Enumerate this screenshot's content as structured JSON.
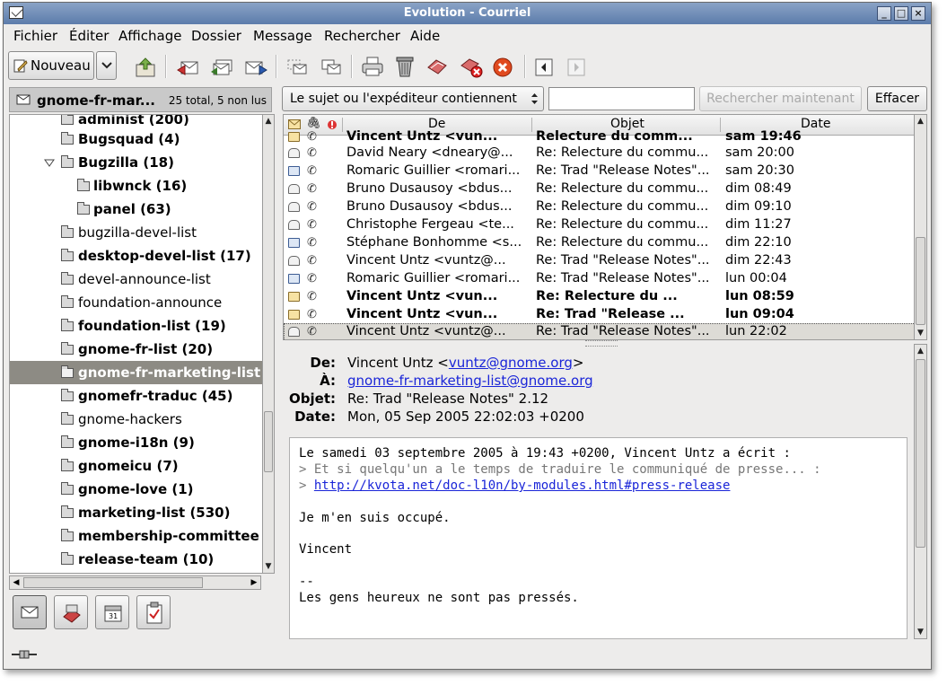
{
  "window": {
    "title": "Evolution - Courriel"
  },
  "menu": [
    "Fichier",
    "Éditer",
    "Affichage",
    "Dossier",
    "Message",
    "Rechercher",
    "Aide"
  ],
  "toolbar": {
    "new_label": "Nouveau"
  },
  "folder_header": {
    "name": "gnome-fr-mar...",
    "count": "25 total, 5 non lus"
  },
  "folders": [
    {
      "label": "administ (200)",
      "bold": true,
      "indent": 2
    },
    {
      "label": "Bugsquad (4)",
      "bold": true,
      "indent": 2
    },
    {
      "label": "Bugzilla (18)",
      "bold": true,
      "indent": 2,
      "expanded": true
    },
    {
      "label": "libwnck (16)",
      "bold": true,
      "indent": 3
    },
    {
      "label": "panel (63)",
      "bold": true,
      "indent": 3
    },
    {
      "label": "bugzilla-devel-list",
      "bold": false,
      "indent": 2
    },
    {
      "label": "desktop-devel-list (17)",
      "bold": true,
      "indent": 2
    },
    {
      "label": "devel-announce-list",
      "bold": false,
      "indent": 2
    },
    {
      "label": "foundation-announce",
      "bold": false,
      "indent": 2
    },
    {
      "label": "foundation-list (19)",
      "bold": true,
      "indent": 2
    },
    {
      "label": "gnome-fr-list (20)",
      "bold": true,
      "indent": 2
    },
    {
      "label": "gnome-fr-marketing-list",
      "bold": true,
      "indent": 2,
      "selected": true
    },
    {
      "label": "gnomefr-traduc (45)",
      "bold": true,
      "indent": 2
    },
    {
      "label": "gnome-hackers",
      "bold": false,
      "indent": 2
    },
    {
      "label": "gnome-i18n (9)",
      "bold": true,
      "indent": 2
    },
    {
      "label": "gnomeicu (7)",
      "bold": true,
      "indent": 2
    },
    {
      "label": "gnome-love (1)",
      "bold": true,
      "indent": 2
    },
    {
      "label": "marketing-list (530)",
      "bold": true,
      "indent": 2
    },
    {
      "label": "membership-committee",
      "bold": true,
      "indent": 2
    },
    {
      "label": "release-team (10)",
      "bold": true,
      "indent": 2
    }
  ],
  "search": {
    "scope": "Le sujet ou l'expéditeur contiennent",
    "query": "",
    "search_now": "Rechercher maintenant",
    "clear": "Effacer"
  },
  "message_list": {
    "columns": {
      "from": "De",
      "subject": "Objet",
      "date": "Date"
    },
    "rows": [
      {
        "from": "Vincent Untz <vun...",
        "subject": "Relecture du comm...",
        "date": "sam 19:46",
        "status": "unread",
        "bold": true
      },
      {
        "from": "David Neary <dneary@...",
        "subject": "Re: Relecture du commu...",
        "date": "sam 20:00",
        "status": "read"
      },
      {
        "from": "Romaric Guillier <romari...",
        "subject": "Re: Trad \"Release Notes\"...",
        "date": "sam 20:30",
        "status": "replied"
      },
      {
        "from": "Bruno Dusausoy <bdus...",
        "subject": "Re: Relecture du commu...",
        "date": "dim 08:49",
        "status": "read"
      },
      {
        "from": "Bruno Dusausoy <bdus...",
        "subject": "Re: Relecture du commu...",
        "date": "dim 09:10",
        "status": "read"
      },
      {
        "from": "Christophe Fergeau <te...",
        "subject": "Re: Relecture du commu...",
        "date": "dim 11:27",
        "status": "read"
      },
      {
        "from": "Stéphane Bonhomme <s...",
        "subject": "Re: Relecture du commu...",
        "date": "dim 22:10",
        "status": "replied"
      },
      {
        "from": "Vincent Untz <vuntz@...",
        "subject": "Re: Trad \"Release Notes\"...",
        "date": "dim 22:43",
        "status": "read"
      },
      {
        "from": "Romaric Guillier <romari...",
        "subject": "Re: Trad \"Release Notes\"...",
        "date": "lun 00:04",
        "status": "replied"
      },
      {
        "from": "Vincent Untz <vun...",
        "subject": "Re: Relecture du ...",
        "date": "lun 08:59",
        "status": "unread",
        "bold": true
      },
      {
        "from": "Vincent Untz <vun...",
        "subject": "Re: Trad \"Release ...",
        "date": "lun 09:04",
        "status": "unread",
        "bold": true
      },
      {
        "from": "Vincent Untz <vuntz@...",
        "subject": "Re: Trad \"Release Notes\"...",
        "date": "lun 22:02",
        "status": "read",
        "selected": true
      }
    ]
  },
  "message": {
    "labels": {
      "from": "De:",
      "to": "À:",
      "subject": "Objet:",
      "date": "Date:"
    },
    "from_name": "Vincent Untz <",
    "from_email": "vuntz@gnome.org",
    "from_close": ">",
    "to": "gnome-fr-marketing-list@gnome.org",
    "subject": "Re: Trad \"Release Notes\" 2.12",
    "date": "Mon, 05 Sep 2005 22:02:03 +0200",
    "body": {
      "line1": "Le samedi 03 septembre 2005 à 19:43 +0200, Vincent Untz a écrit :",
      "quote1": "> Et si quelqu'un a le temps de traduire le communiqué de presse... :",
      "quote2_prefix": "> ",
      "quote2_link": "http://kvota.net/doc-l10n/by-modules.html#press-release",
      "line2": "Je m'en suis occupé.",
      "line3": "Vincent",
      "sig_sep": "--",
      "sig": "Les gens heureux ne sont pas pressés."
    }
  }
}
